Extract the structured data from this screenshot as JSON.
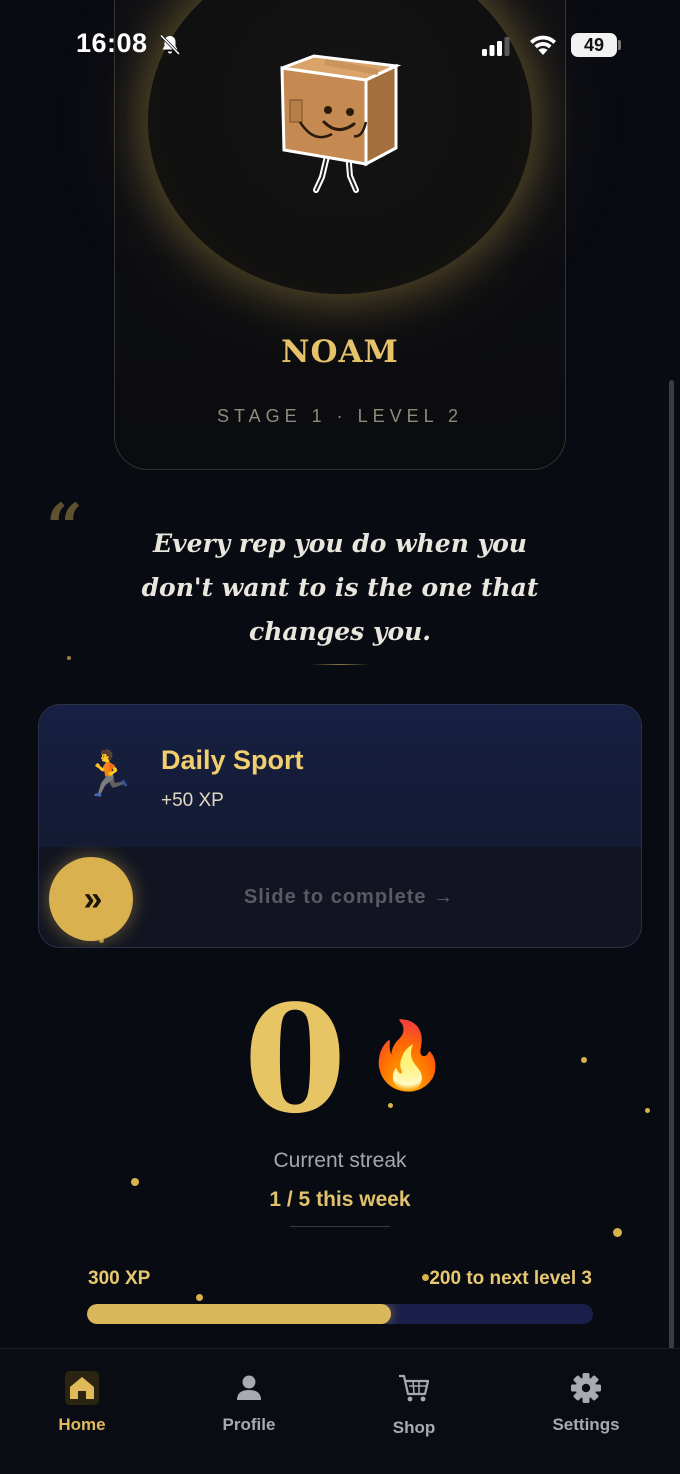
{
  "status_bar": {
    "time": "16:08",
    "battery": "49"
  },
  "profile": {
    "name": "NOAM",
    "stage_level": "STAGE 1 · LEVEL 2"
  },
  "quote": {
    "mark": "“",
    "text": "Every rep you do when you don't want to is the one that changes you."
  },
  "task": {
    "icon": "🏃",
    "title": "Daily Sport",
    "xp": "+50 XP",
    "slide_knob": "»",
    "slide_label": "Slide to complete →"
  },
  "streak": {
    "count": "0",
    "icon": "🔥",
    "label": "Current streak",
    "week_progress": "1 / 5 this week"
  },
  "xp": {
    "current": "300 XP",
    "next": "200 to next level 3",
    "progress_fraction": 0.6
  },
  "tabs": [
    {
      "label": "Home",
      "icon": "home-icon",
      "active": true
    },
    {
      "label": "Profile",
      "icon": "person-icon",
      "active": false
    },
    {
      "label": "Shop",
      "icon": "cart-icon",
      "active": false
    },
    {
      "label": "Settings",
      "icon": "gear-icon",
      "active": false
    }
  ],
  "colors": {
    "accent_gold": "#e6c26a",
    "background": "#090b12",
    "card_navy": "#172042",
    "progress_track": "#1a1f4a"
  }
}
